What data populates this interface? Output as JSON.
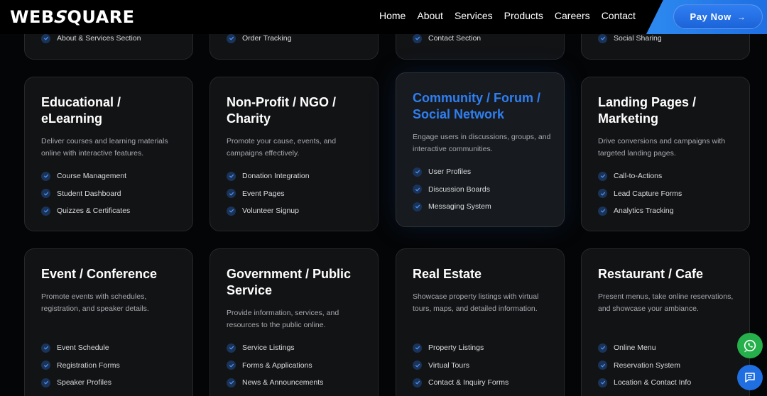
{
  "brand": {
    "logo_left": "WEB",
    "logo_slash": "S",
    "logo_right": "QUARE"
  },
  "nav": {
    "links": [
      "Home",
      "About",
      "Services",
      "Products",
      "Careers",
      "Contact"
    ],
    "pay_label": "Pay Now"
  },
  "top_partial": [
    "About & Services Section",
    "Order Tracking",
    "Contact Section",
    "Social Sharing"
  ],
  "cards": [
    {
      "title": "Educational / eLearning",
      "desc": "Deliver courses and learning materials online with interactive features.",
      "items": [
        "Course Management",
        "Student Dashboard",
        "Quizzes & Certificates"
      ]
    },
    {
      "title": "Non-Profit / NGO / Charity",
      "desc": "Promote your cause, events, and campaigns effectively.",
      "items": [
        "Donation Integration",
        "Event Pages",
        "Volunteer Signup"
      ]
    },
    {
      "title": "Community / Forum / Social Network",
      "desc": "Engage users in discussions, groups, and interactive communities.",
      "items": [
        "User Profiles",
        "Discussion Boards",
        "Messaging System"
      ]
    },
    {
      "title": "Landing Pages / Marketing",
      "desc": "Drive conversions and campaigns with targeted landing pages.",
      "items": [
        "Call-to-Actions",
        "Lead Capture Forms",
        "Analytics Tracking"
      ]
    },
    {
      "title": "Event / Conference",
      "desc": "Promote events with schedules, registration, and speaker details.",
      "items": [
        "Event Schedule",
        "Registration Forms",
        "Speaker Profiles"
      ]
    },
    {
      "title": "Government / Public Service",
      "desc": "Provide information, services, and resources to the public online.",
      "items": [
        "Service Listings",
        "Forms & Applications",
        "News & Announcements"
      ]
    },
    {
      "title": "Real Estate",
      "desc": "Showcase property listings with virtual tours, maps, and detailed information.",
      "items": [
        "Property Listings",
        "Virtual Tours",
        "Contact & Inquiry Forms"
      ]
    },
    {
      "title": "Restaurant / Cafe",
      "desc": "Present menus, take online reservations, and showcase your ambiance.",
      "items": [
        "Online Menu",
        "Reservation System",
        "Location & Contact Info"
      ]
    }
  ],
  "colors": {
    "accent": "#2f7ff2",
    "whatsapp": "#25b04b"
  }
}
